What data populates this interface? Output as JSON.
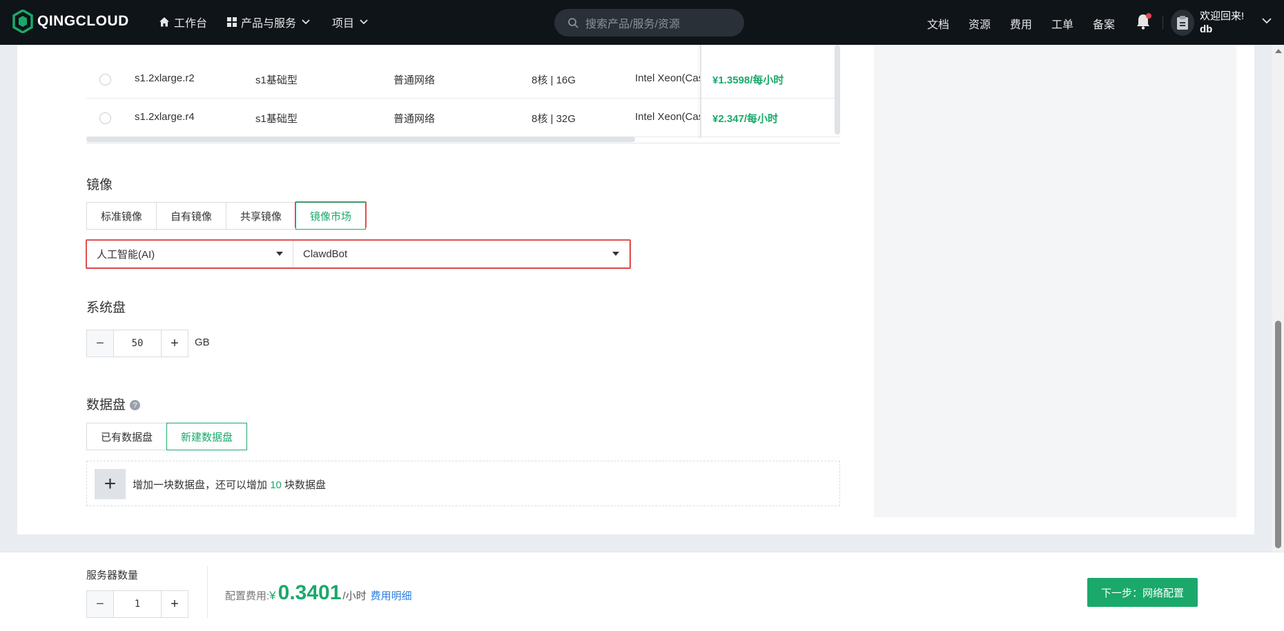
{
  "nav": {
    "brand": "QINGCLOUD",
    "workbench": "工作台",
    "products": "产品与服务",
    "projects": "项目",
    "search_placeholder": "搜索产品/服务/资源",
    "links": [
      "文档",
      "资源",
      "费用",
      "工单",
      "备案"
    ],
    "welcome": "欢迎回来!",
    "user": "db"
  },
  "instance_table": {
    "rows": [
      {
        "type": "s1.2xlarge.r2",
        "family": "s1基础型",
        "network": "普通网络",
        "spec": "8核 | 16G",
        "cpu": "Intel Xeon(Cas",
        "price": "¥1.3598/每小时"
      },
      {
        "type": "s1.2xlarge.r4",
        "family": "s1基础型",
        "network": "普通网络",
        "spec": "8核 | 32G",
        "cpu": "Intel Xeon(Cas",
        "price": "¥2.347/每小时"
      }
    ]
  },
  "image": {
    "title": "镜像",
    "tabs": [
      "标准镜像",
      "自有镜像",
      "共享镜像",
      "镜像市场"
    ],
    "active_tab": "镜像市场",
    "category": "人工智能(AI)",
    "app": "ClawdBot"
  },
  "system_disk": {
    "title": "系统盘",
    "value": "50",
    "unit": "GB",
    "minus": "−",
    "plus": "+"
  },
  "data_disk": {
    "title": "数据盘",
    "help": "?",
    "tabs": [
      "已有数据盘",
      "新建数据盘"
    ],
    "active_tab": "新建数据盘",
    "add_plus": "+",
    "add_text_1": "增加一块数据盘，还可以增加",
    "add_count": "10",
    "add_text_2": "块数据盘"
  },
  "footer": {
    "server_count_label": "服务器数量",
    "server_count": "1",
    "minus": "−",
    "plus": "+",
    "cost_label": "配置费用:",
    "currency": "¥",
    "cost": "0.3401",
    "cost_unit": "/小时",
    "cost_detail": "费用明细",
    "next_button": "下一步：网络配置"
  },
  "colors": {
    "accent": "#1aa96a",
    "nav_bg": "#0f1419",
    "link": "#2a7ee0",
    "highlight": "#e05050"
  }
}
